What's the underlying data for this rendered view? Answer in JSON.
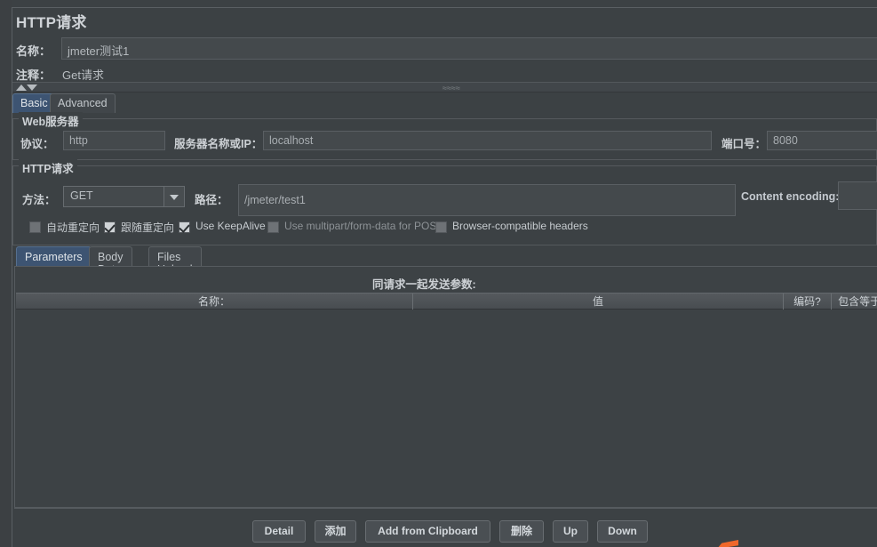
{
  "window": {
    "title": "HTTP请求",
    "background": "#3c4144",
    "accent": "#3d5472"
  },
  "name_row": {
    "label": "名称：",
    "value": "jmeter测试1"
  },
  "comment_row": {
    "label": "注释：",
    "value": "Get请求"
  },
  "splitter": {
    "grip": "≈≈≈≈",
    "up_icon": "triangle-up-icon",
    "down_icon": "triangle-down-icon"
  },
  "top_tabs": [
    {
      "label": "Basic",
      "active": true
    },
    {
      "label": "Advanced",
      "active": false
    }
  ],
  "web_server": {
    "legend": "Web服务器",
    "protocol_label": "协议：",
    "protocol_value": "http",
    "server_label": "服务器名称或IP：",
    "server_value": "localhost",
    "port_label": "端口号：",
    "port_value": "8080"
  },
  "http_request": {
    "legend": "HTTP请求",
    "method_label": "方法：",
    "method_value": "GET",
    "path_label": "路径：",
    "path_value": "/jmeter/test1",
    "encoding_label": "Content encoding:",
    "encoding_value": ""
  },
  "checkboxes": [
    {
      "label": "自动重定向",
      "checked": false,
      "disabled": false
    },
    {
      "label": "跟随重定向",
      "checked": true,
      "disabled": false
    },
    {
      "label": "Use KeepAlive",
      "checked": true,
      "disabled": false
    },
    {
      "label": "Use multipart/form-data for POST",
      "checked": false,
      "disabled": true
    },
    {
      "label": "Browser-compatible headers",
      "checked": false,
      "disabled": false
    }
  ],
  "inner_tabs": [
    {
      "label": "Parameters",
      "active": true
    },
    {
      "label": "Body Data",
      "active": false
    },
    {
      "label": "Files Upload",
      "active": false
    }
  ],
  "params_panel": {
    "title": "同请求一起发送参数:",
    "columns": [
      "名称：",
      "值",
      "编码?",
      "包含等于?"
    ],
    "rows": []
  },
  "buttons": [
    {
      "label": "Detail"
    },
    {
      "label": "添加"
    },
    {
      "label": "Add from Clipboard"
    },
    {
      "label": "删除"
    },
    {
      "label": "Up"
    },
    {
      "label": "Down"
    }
  ],
  "marker": {
    "name": "orange-cursor-fragment",
    "color": "#f0682b"
  }
}
